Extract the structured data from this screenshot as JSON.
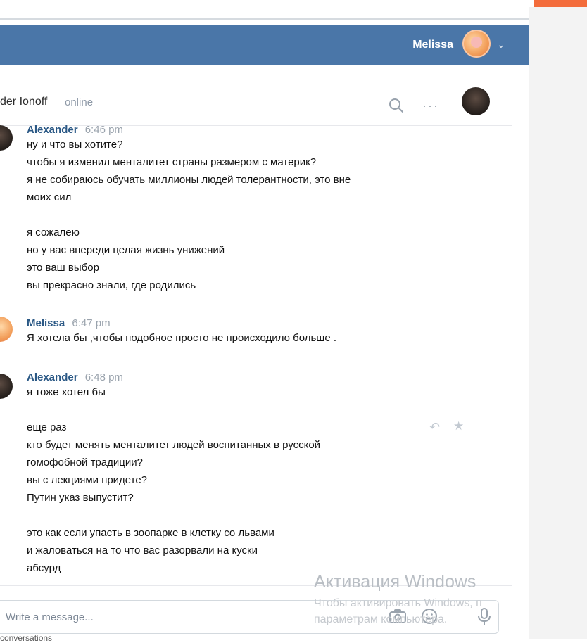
{
  "header": {
    "user_name": "Melissa"
  },
  "chat": {
    "name": "der Ionoff",
    "status": "online"
  },
  "messages": [
    {
      "author": "Alexander",
      "time": "6:46 pm",
      "lines": [
        "ну и что вы хотите?",
        "чтобы я изменил менталитет страны размером с материк?",
        "я не собираюсь обучать миллионы людей толерантности, это вне",
        "моих сил",
        "",
        "я сожалею",
        "но у вас впереди целая жизнь унижений",
        "это ваш выбор",
        "вы прекрасно знали, где родились"
      ]
    },
    {
      "author": "Melissa",
      "time": "6:47 pm",
      "lines": [
        "Я хотела бы ,чтобы подобное просто не происходило больше ."
      ]
    },
    {
      "author": "Alexander",
      "time": "6:48 pm",
      "lines": [
        "я тоже хотел бы",
        "",
        "еще раз",
        "кто будет менять менталитет людей воспитанных в русской",
        "гомофобной традиции?",
        "вы с лекциями придете?",
        "Путин указ выпустит?",
        "",
        "это как если упасть в зоопарке в клетку со львами",
        "и жаловаться на то что вас разорвали на куски",
        "абсурд"
      ]
    }
  ],
  "composer": {
    "placeholder": "Write a message..."
  },
  "watermark": {
    "line1": "Активация Windows",
    "line2": "Чтобы активировать Windows, п",
    "line3": "параметрам компьютера."
  },
  "bottom_text": "conversations",
  "icons": {
    "search": "search-icon",
    "more": "more-icon",
    "reply": "reply-icon",
    "star": "star-icon",
    "camera": "camera-icon",
    "smile": "smile-icon",
    "mic": "mic-icon",
    "chevron": "chevron-down-icon"
  },
  "colors": {
    "header": "#4a76a8",
    "author": "#2a5885",
    "accent": "#f36c3b"
  }
}
